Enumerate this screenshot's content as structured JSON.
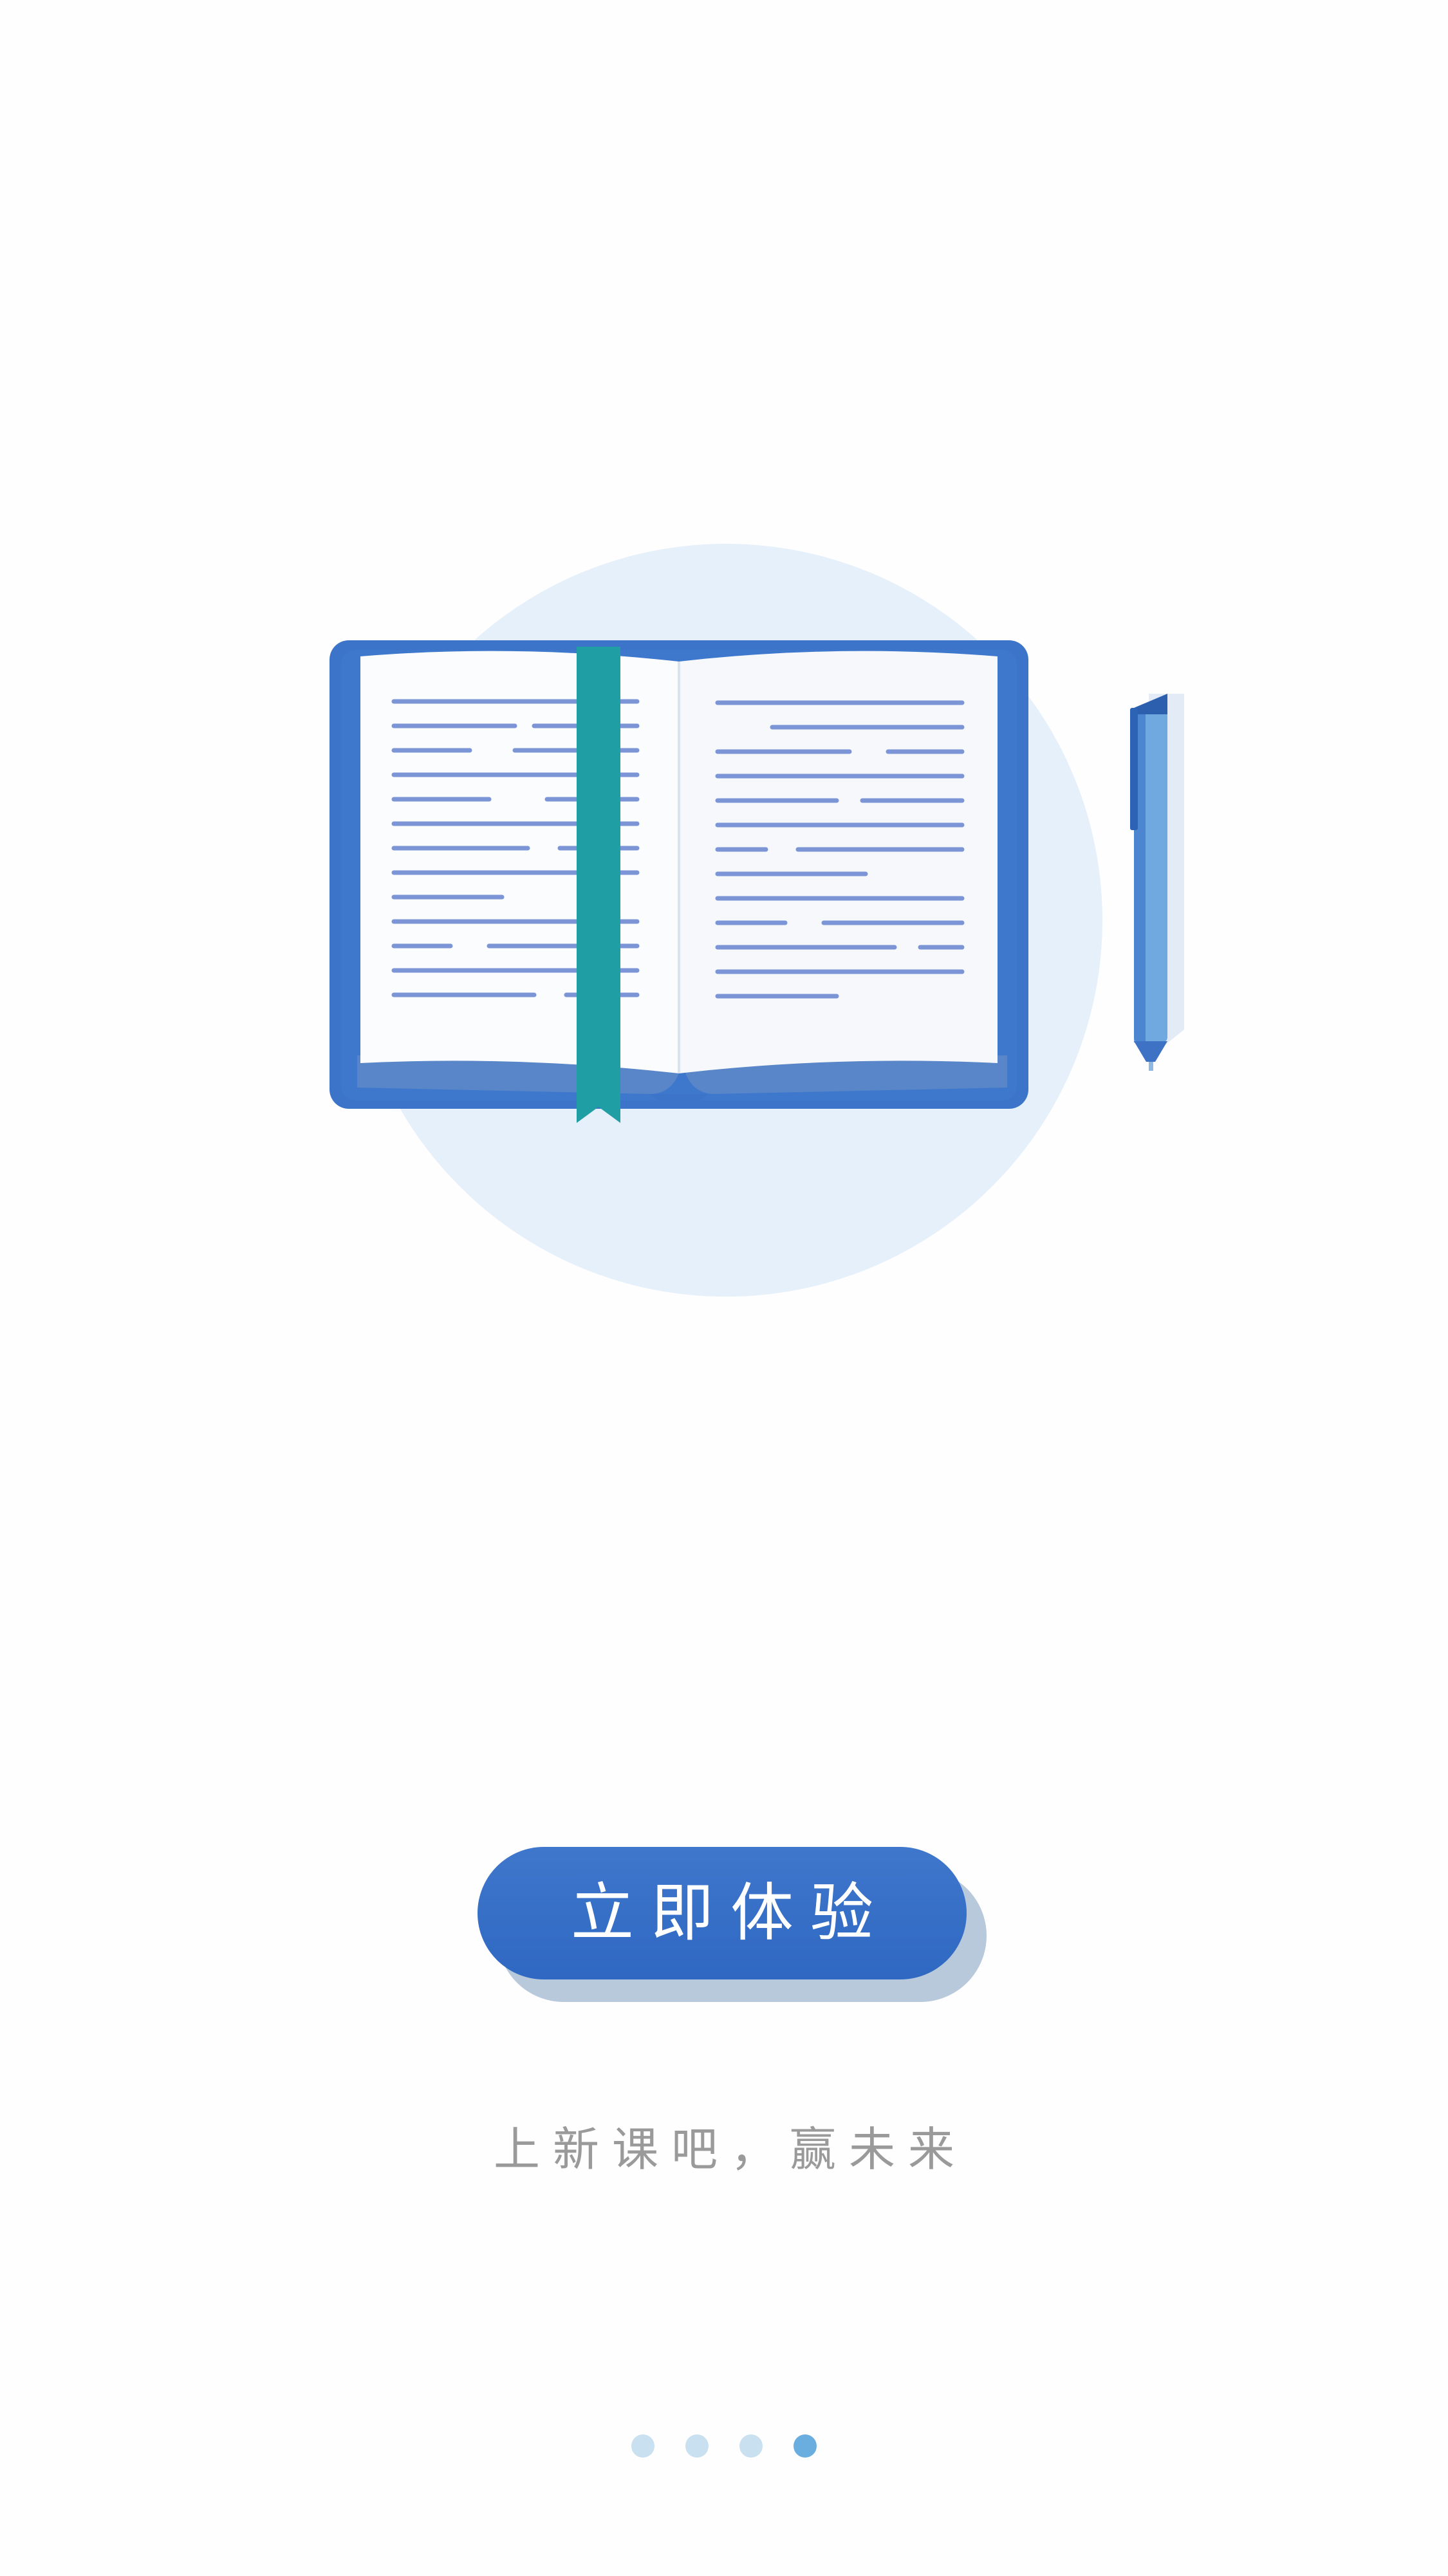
{
  "onboarding": {
    "cta_label": "立即体验",
    "tagline": "上新课吧，赢未来",
    "pager": {
      "total": 4,
      "active_index": 3
    }
  },
  "colors": {
    "accent": "#3a72c8",
    "circle": "#e6f0fa",
    "bookmark": "#1f9ea4",
    "text_lines": "#7b95d6",
    "tagline": "#9a9a9a",
    "dot": "#c9e0f0",
    "dot_active": "#6aaedf"
  },
  "icons": {
    "hero": "open-book-icon",
    "pen": "pen-icon"
  }
}
